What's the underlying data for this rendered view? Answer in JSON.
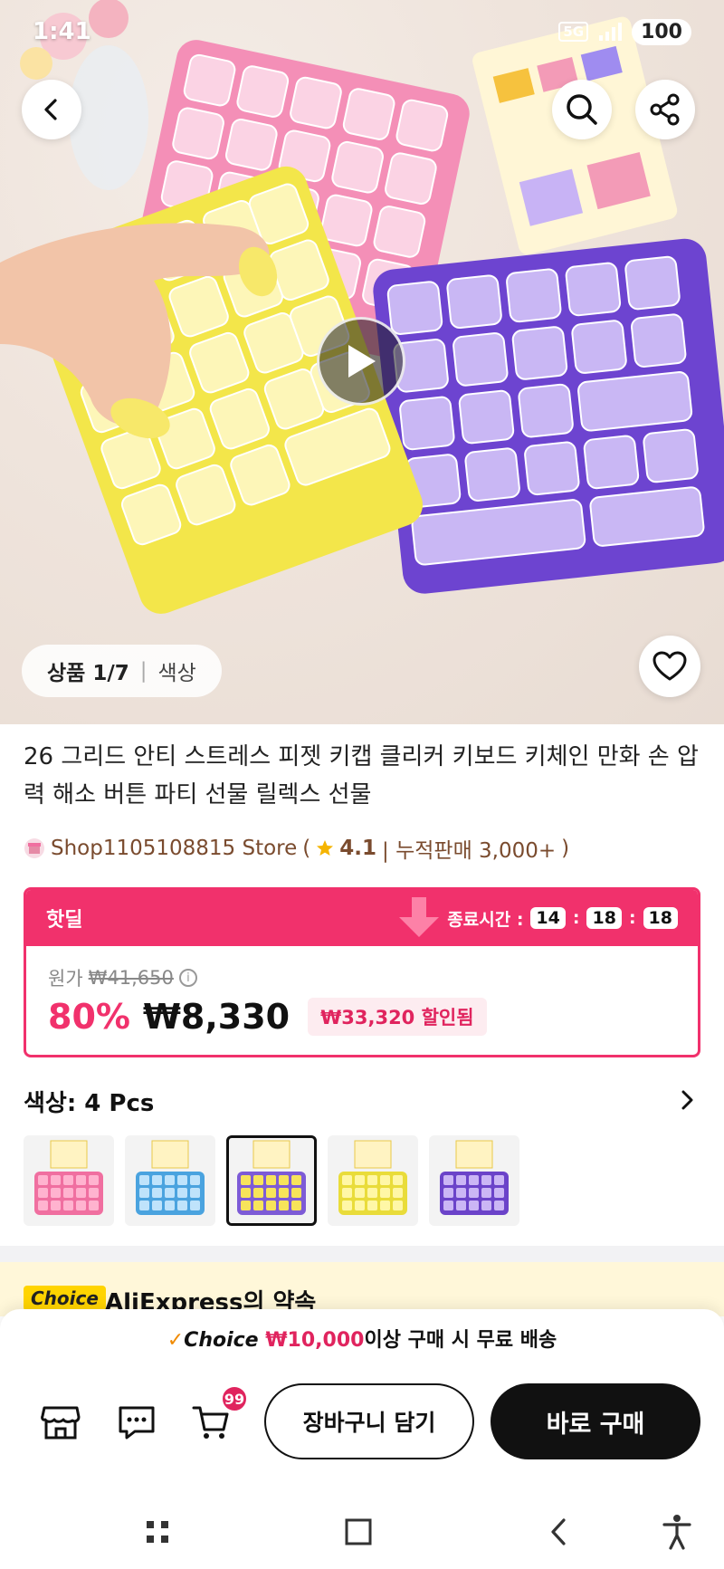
{
  "status_bar": {
    "time": "1:41",
    "network": "5G",
    "battery": "100"
  },
  "gallery": {
    "counter": "상품 1/7",
    "tab": "색상"
  },
  "product": {
    "title": "26 그리드 안티 스트레스 피젯 키캡 클리커 키보드 키체인 만화 손 압력 해소 버튼 파티 선물 릴렉스 선물"
  },
  "store": {
    "name": "Shop1105108815 Store",
    "open_paren": "(",
    "rating": "4.1",
    "sales": "| 누적판매 3,000+",
    "close_paren": ")"
  },
  "deal": {
    "title": "핫딜",
    "ends_label": "종료시간 :",
    "hours": "14",
    "minutes": "18",
    "seconds": "18",
    "separator": ":",
    "original_label": "원가",
    "original_price": "₩41,650",
    "discount_percent": "80%",
    "price": "₩8,330",
    "savings": "₩33,320 할인됨"
  },
  "options": {
    "color_label": "색상: 4 Pcs",
    "variants": [
      {
        "name": "pink",
        "color": "#f06fa0",
        "keys": "#ffb3cf"
      },
      {
        "name": "blue",
        "color": "#4aa3df",
        "keys": "#bfe3fb"
      },
      {
        "name": "mixed",
        "color": "#7d5bd6",
        "keys": "#f7e45a"
      },
      {
        "name": "yellow",
        "color": "#e9dc3a",
        "keys": "#fff7a6"
      },
      {
        "name": "purple",
        "color": "#6b43c9",
        "keys": "#cbb6f5"
      }
    ],
    "selected_index": 2
  },
  "choice_strip": {
    "badge": "Choice",
    "text": "AliExpress의 약속"
  },
  "bottom_bar": {
    "check_mark": "✓",
    "choice_word": "Choice",
    "amount": "₩10,000",
    "rest": "이상 구매 시 무료 배송",
    "cart_count": "99",
    "add_to_cart": "장바구니 담기",
    "buy_now": "바로 구매"
  },
  "colors": {
    "accent": "#f1316c",
    "sale_red": "#e0245e",
    "store_brown": "#7a4b2e",
    "choice_yellow": "#ffd400"
  }
}
